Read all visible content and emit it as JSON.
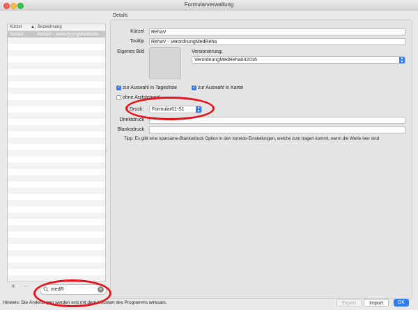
{
  "window": {
    "title": "Formularverwaltung"
  },
  "list": {
    "columns": {
      "kuerzel": "Kürzel",
      "bezeichnung": "Bezeichnung",
      "sort_indicator": "▲"
    },
    "selected_row": {
      "kuerzel": "RehaV",
      "bezeichnung": "RehaV - VerordnungMedReha"
    }
  },
  "list_controls": {
    "add": "+",
    "remove": "−"
  },
  "search": {
    "value": "medR",
    "clear": "×"
  },
  "details": {
    "section_title": "Details",
    "kuerzel_label": "Kürzel",
    "kuerzel_value": "RehaV",
    "tooltip_label": "Tooltip",
    "tooltip_value": "RehaV - VerordnungMedReha",
    "image_label": "Eigenes Bild",
    "versioning_label": "Versionierung:",
    "versioning_value": "VerordnungMedReha042016",
    "cb_tagesliste_label": "zur Auswahl in Tagesliste",
    "cb_tagesliste_checked": true,
    "cb_kartei_label": "zur Auswahl in Kartei",
    "cb_kartei_checked": true,
    "cb_arztstempel_label": "ohne Arztstempel",
    "cb_arztstempel_checked": false,
    "druck_label": "Druck:",
    "druck_value": "Formular61-S1",
    "direktdruck_label": "Direktdruck",
    "direktdruck_value": "",
    "blankodruck_label": "Blankodruck",
    "blankodruck_value": "",
    "tip": "Tipp: Es gibt eine sparsame-Blankodruck Option in den tomedo-Einstellungen, welche zum tragen kommt, wenn die  Werte leer sind"
  },
  "footer": {
    "hint": "Hinweis: Die Änderungen werden erst mit dem Neustart des Programms wirksam.",
    "export": "Export",
    "import": "Import",
    "ok": "OK"
  },
  "colors": {
    "accent": "#2f7cf6",
    "annotation": "#e8131a",
    "selection": "#c6c6c6"
  },
  "icons": {
    "search": "search-icon",
    "clear": "clear-icon",
    "popup": "chevron-updown-icon",
    "check": "checkmark-icon"
  }
}
